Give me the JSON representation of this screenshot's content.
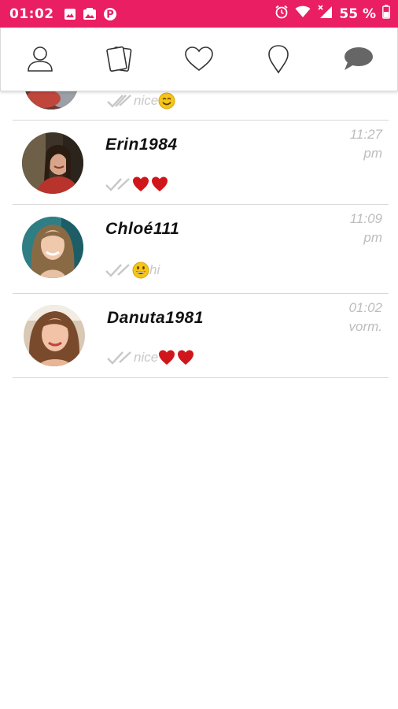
{
  "status_bar": {
    "time": "01:02",
    "battery": "55 %"
  },
  "nav": {
    "items": [
      {
        "icon": "profile-icon"
      },
      {
        "icon": "cards-icon"
      },
      {
        "icon": "heart-icon"
      },
      {
        "icon": "location-pin-icon"
      },
      {
        "icon": "chat-bubble-icon"
      }
    ]
  },
  "conversations": [
    {
      "name": "",
      "preview_text": "nice",
      "preview_emoji": "smile",
      "time": "",
      "partial": true
    },
    {
      "name": "Erin1984",
      "preview_text": "",
      "preview_emoji": "two-hearts",
      "time_line1": "11:27",
      "time_line2": "pm"
    },
    {
      "name": "Chloé111",
      "preview_text": "hi",
      "preview_emoji": "grin",
      "time_line1": "11:09",
      "time_line2": "pm"
    },
    {
      "name": "Danuta1981",
      "preview_text": "nice",
      "preview_emoji": "two-hearts",
      "time_line1": "01:02",
      "time_line2": "vorm."
    }
  ]
}
